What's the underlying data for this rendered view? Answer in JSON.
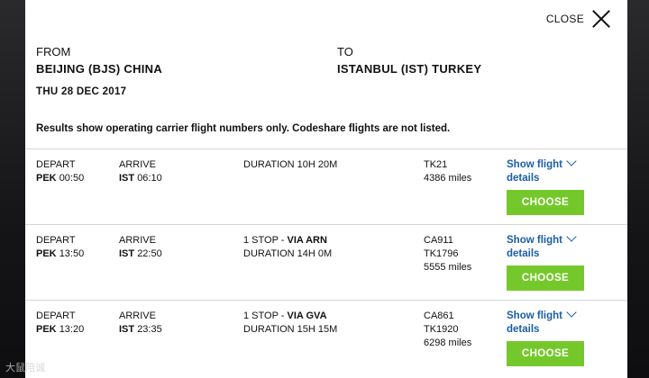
{
  "close_label": "CLOSE",
  "route": {
    "from_label": "FROM",
    "from_city": "BEIJING (BJS) CHINA",
    "to_label": "TO",
    "to_city": "ISTANBUL (IST) TURKEY",
    "date": "THU 28 DEC 2017"
  },
  "notice": "Results show operating carrier flight numbers only. Codeshare flights are not listed.",
  "labels": {
    "depart": "DEPART",
    "arrive": "ARRIVE",
    "show_flight": "Show flight",
    "details": "details",
    "choose": "CHOOSE"
  },
  "flights": [
    {
      "dep_code": "PEK",
      "dep_time": "00:50",
      "arr_code": "IST",
      "arr_time": "06:10",
      "stops": "",
      "via": "",
      "duration": "DURATION 10H 20M",
      "flight_numbers": [
        "TK21"
      ],
      "miles": "4386 miles"
    },
    {
      "dep_code": "PEK",
      "dep_time": "13:50",
      "arr_code": "IST",
      "arr_time": "22:50",
      "stops": "1 STOP - ",
      "via": "VIA ARN",
      "duration": "DURATION 14H 0M",
      "flight_numbers": [
        "CA911",
        "TK1796"
      ],
      "miles": "5555 miles"
    },
    {
      "dep_code": "PEK",
      "dep_time": "13:20",
      "arr_code": "IST",
      "arr_time": "23:35",
      "stops": "1 STOP - ",
      "via": "VIA GVA",
      "duration": "DURATION 15H 15M",
      "flight_numbers": [
        "CA861",
        "TK1920"
      ],
      "miles": "6298 miles"
    }
  ],
  "watermark": "大鼠陪诚"
}
